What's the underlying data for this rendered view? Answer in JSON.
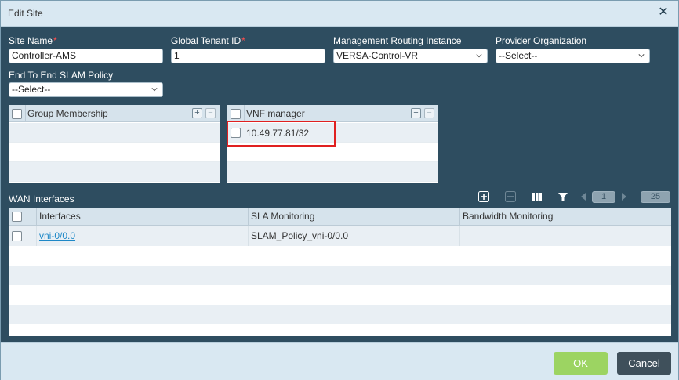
{
  "dialog": {
    "title": "Edit Site"
  },
  "form": {
    "site_name": {
      "label": "Site Name",
      "value": "Controller-AMS"
    },
    "global_tenant_id": {
      "label": "Global Tenant ID",
      "value": "1"
    },
    "mgmt_routing_instance": {
      "label": "Management Routing Instance",
      "value": "VERSA-Control-VR"
    },
    "provider_org": {
      "label": "Provider Organization",
      "value": "--Select--"
    },
    "slam_policy": {
      "label": "End To End SLAM Policy",
      "value": "--Select--"
    },
    "required_mark": "*"
  },
  "group_membership": {
    "header": "Group Membership"
  },
  "vnf_manager": {
    "header": "VNF manager",
    "rows": [
      "10.49.77.81/32"
    ]
  },
  "wan": {
    "title": "WAN Interfaces",
    "page": "1",
    "page_size": "25",
    "columns": [
      "Interfaces",
      "SLA Monitoring",
      "Bandwidth Monitoring"
    ],
    "rows": [
      {
        "interface": "vni-0/0.0",
        "sla": "SLAM_Policy_vni-0/0.0",
        "bandwidth": ""
      }
    ]
  },
  "footer": {
    "ok": "OK",
    "cancel": "Cancel"
  },
  "colors": {
    "ok_button": "#9cd462",
    "cancel_button": "#3f505b",
    "highlight": "#e02020",
    "link": "#1e88c7"
  }
}
